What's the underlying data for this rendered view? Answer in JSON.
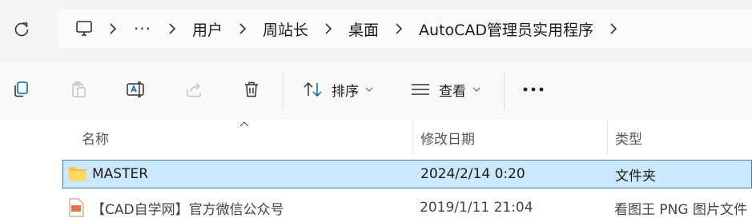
{
  "addressbar": {
    "breadcrumb": [
      "用户",
      "周站长",
      "桌面",
      "AutoCAD管理员实用程序"
    ],
    "more_label": "···"
  },
  "toolbar": {
    "sort_label": "排序",
    "view_label": "查看",
    "more_label": "•••"
  },
  "columns": {
    "name": "名称",
    "modified": "修改日期",
    "type": "类型"
  },
  "rows": [
    {
      "name": "MASTER",
      "modified": "2024/2/14 0:20",
      "type": "文件夹",
      "selected": true
    },
    {
      "name": "【CAD自学网】官方微信公众号",
      "modified": "2019/1/11 21:04",
      "type": "看图王 PNG 图片文件",
      "selected": false
    }
  ],
  "colors": {
    "selection_bg": "#cce8ff",
    "selection_border": "#3c7fb1",
    "folder": "#f6c443",
    "accent": "#0067c0"
  }
}
